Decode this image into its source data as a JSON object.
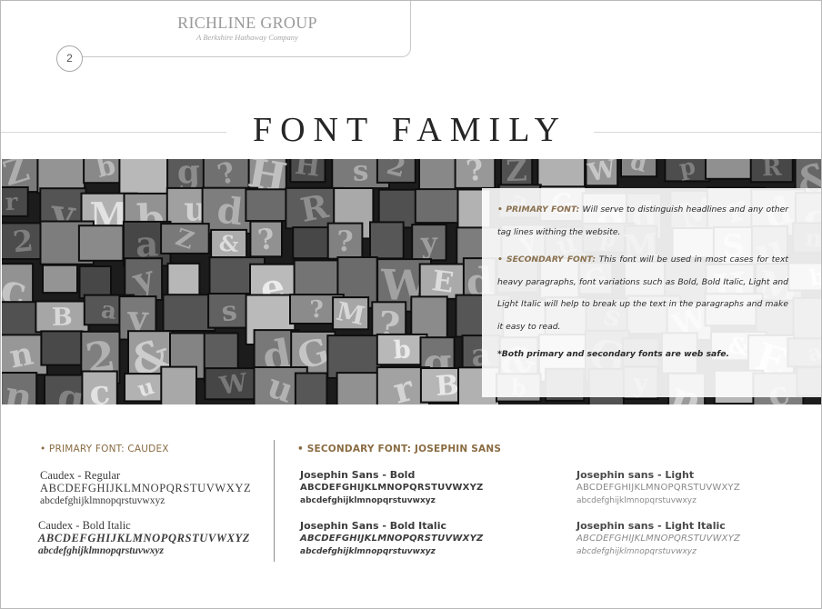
{
  "header": {
    "brand_name": "RICHLINE GROUP",
    "brand_subtitle": "A Berkshire Hathaway Company",
    "page_number": "2"
  },
  "title": "FONT FAMILY",
  "hero": {
    "image_description_icon": "letterpress-type-blocks-photo",
    "primary_lead": "• PRIMARY FONT:",
    "primary_text": " Will serve to distinguish headlines and any other tag lines withing the website.",
    "secondary_lead": "• SECONDARY FONT:",
    "secondary_text": " This font will be used in most cases for text heavy paragraphs, font variations such as Bold, Bold Italic, Light and Light Italic will help to break up the text in the paragraphs and make it easy to read.",
    "note": "*Both primary and secondary fonts are web safe."
  },
  "primary": {
    "heading": "• PRIMARY FONT: CAUDEX",
    "specimens": [
      {
        "name": "Caudex - Regular",
        "upper": "ABCDEFGHIJKLMNOPQRSTUVWXYZ",
        "lower": "abcdefghijklmnopqrstuvwxyz"
      },
      {
        "name": "Caudex - Bold Italic",
        "upper": "ABCDEFGHIJKLMNOPQRSTUVWXYZ",
        "lower": "abcdefghijklmnopqrstuvwxyz"
      }
    ]
  },
  "secondary": {
    "heading": "• SECONDARY FONT: JOSEPHIN SANS",
    "specimens": [
      {
        "name": "Josephin Sans - Bold",
        "upper": "ABCDEFGHIJKLMNOPQRSTUVWXYZ",
        "lower": "abcdefghijklmnopqrstuvwxyz"
      },
      {
        "name": "Josephin Sans - Bold Italic",
        "upper": "ABCDEFGHIJKLMNOPQRSTUVWXYZ",
        "lower": "abcdefghijklmnopqrstuvwxyz"
      },
      {
        "name": "Josephin sans - Light",
        "upper": "ABCDEFGHIJKLMNOPQRSTUVWXYZ",
        "lower": "abcdefghijklmnopqrstuvwxyz"
      },
      {
        "name": "Josephin sans - Light Italic",
        "upper": "ABCDEFGHIJKLMNOPQRSTUVWXYZ",
        "lower": "abcdefghijklmnopqrstuvwxyz"
      }
    ]
  },
  "colors": {
    "accent_gold": "#8a6c43",
    "text_dark": "#3c3c3c",
    "text_light": "#8a8a8a"
  }
}
